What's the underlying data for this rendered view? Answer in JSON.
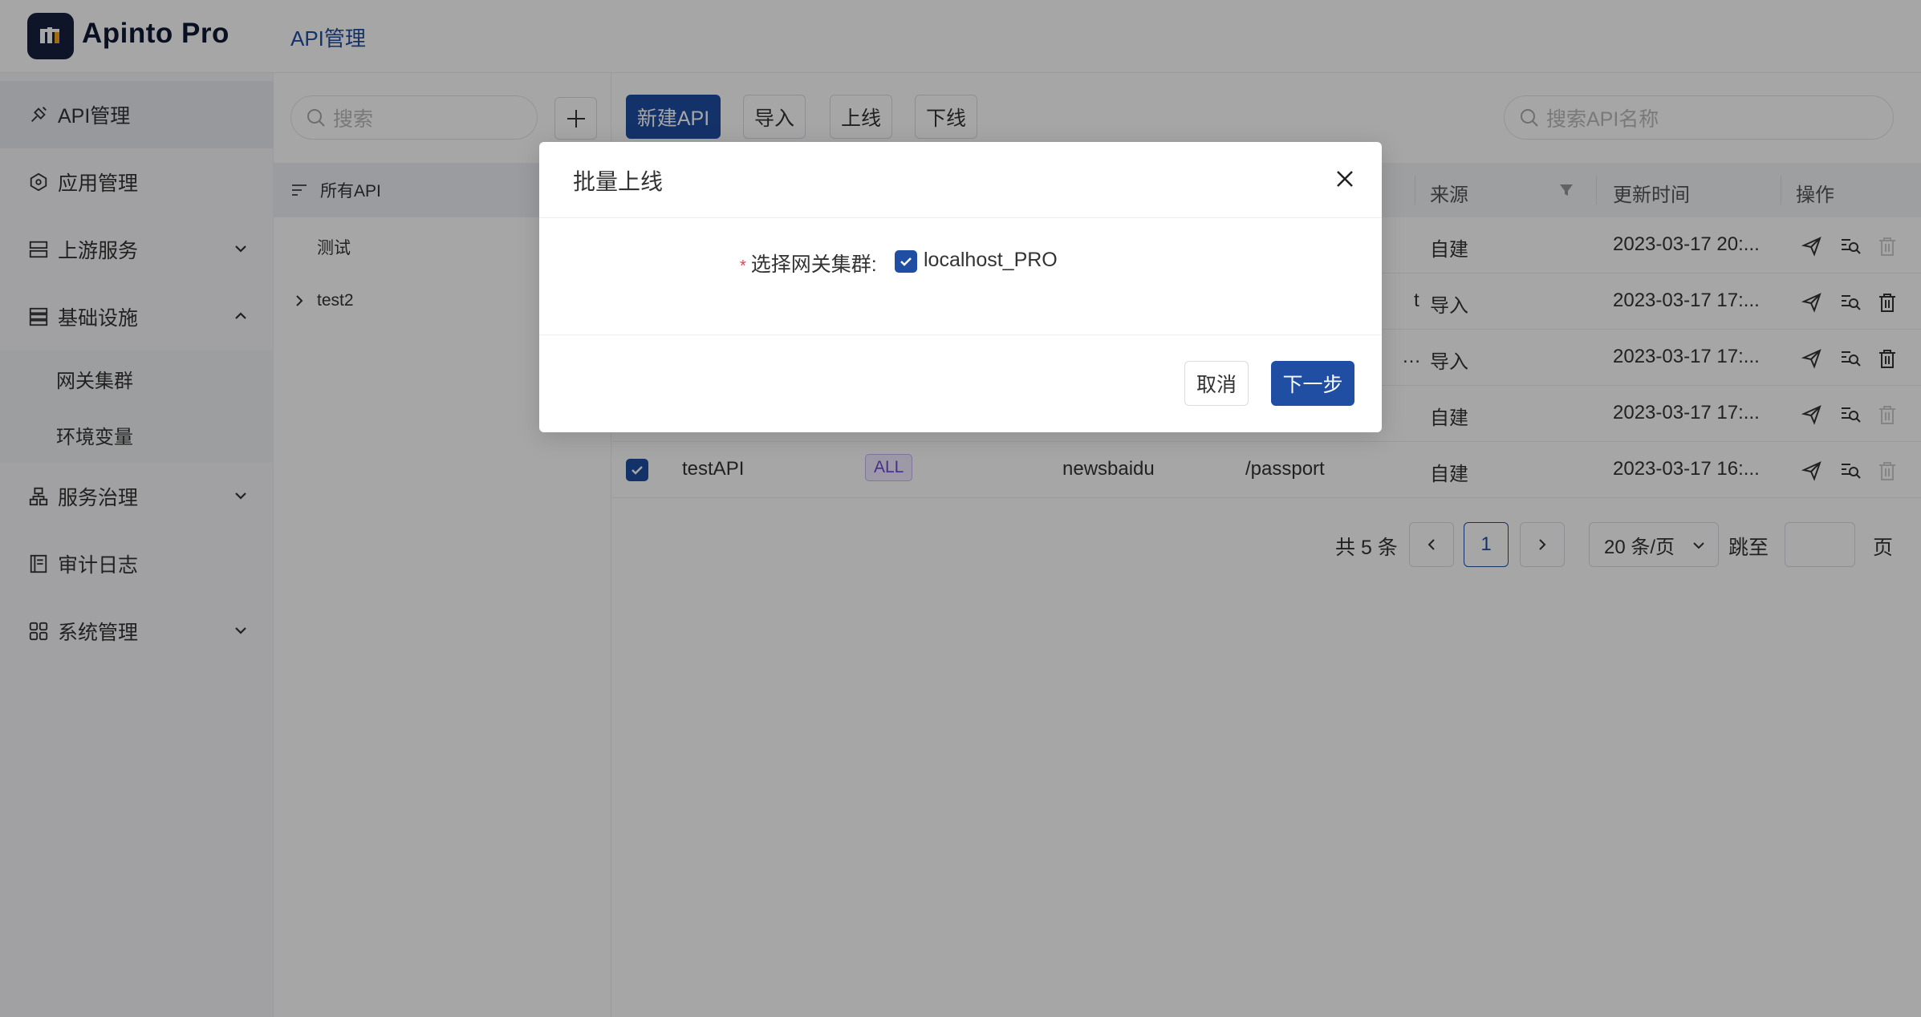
{
  "app": {
    "brand": "Apinto Pro",
    "header_crumb": "API管理"
  },
  "sidebar": {
    "items": [
      {
        "label": "API管理",
        "icon": "api-icon",
        "active": true
      },
      {
        "label": "应用管理",
        "icon": "app-icon"
      },
      {
        "label": "上游服务",
        "icon": "upstream-icon",
        "expandable": true
      },
      {
        "label": "基础设施",
        "icon": "infra-icon",
        "expanded": true
      },
      {
        "label": "服务治理",
        "icon": "governance-icon",
        "expandable": true
      },
      {
        "label": "审计日志",
        "icon": "audit-log-icon"
      },
      {
        "label": "系统管理",
        "icon": "system-icon",
        "expandable": true
      }
    ],
    "subitems": [
      {
        "label": "网关集群"
      },
      {
        "label": "环境变量"
      }
    ]
  },
  "tree": {
    "search_placeholder": "搜索",
    "all_label": "所有API",
    "nodes": [
      {
        "label": "测试"
      },
      {
        "label": "test2"
      }
    ]
  },
  "toolbar": {
    "new_api": "新建API",
    "import": "导入",
    "online": "上线",
    "offline": "下线",
    "search_placeholder": "搜索API名称"
  },
  "table": {
    "headers": {
      "source": "来源",
      "updated": "更新时间",
      "actions": "操作"
    },
    "rows": [
      {
        "name": "",
        "method": "",
        "service": "",
        "path": "",
        "source": "自建",
        "updated": "2023-03-17 20:...",
        "trunc": ""
      },
      {
        "name": "",
        "method": "",
        "service": "",
        "path": "",
        "source": "导入",
        "updated": "2023-03-17 17:...",
        "trunc": "t"
      },
      {
        "name": "",
        "method": "",
        "service": "",
        "path": "",
        "source": "导入",
        "updated": "2023-03-17 17:...",
        "trunc": "…"
      },
      {
        "name": "",
        "method": "",
        "service": "",
        "path": "",
        "source": "自建",
        "updated": "2023-03-17 17:...",
        "trunc": ""
      },
      {
        "name": "testAPI",
        "method": "ALL",
        "service": "newsbaidu",
        "path": "/passport",
        "source": "自建",
        "updated": "2023-03-17 16:...",
        "trunc": ""
      }
    ]
  },
  "pagination": {
    "total": "共 5 条",
    "current": "1",
    "page_size": "20 条/页",
    "jump_to": "跳至",
    "page_suffix": "页"
  },
  "modal": {
    "title": "批量上线",
    "field_label": "选择网关集群:",
    "required_mark": "*",
    "option": "localhost_PRO",
    "cancel": "取消",
    "next": "下一步"
  },
  "colors": {
    "primary": "#1f4ea3",
    "brand_dark": "#16213e"
  }
}
